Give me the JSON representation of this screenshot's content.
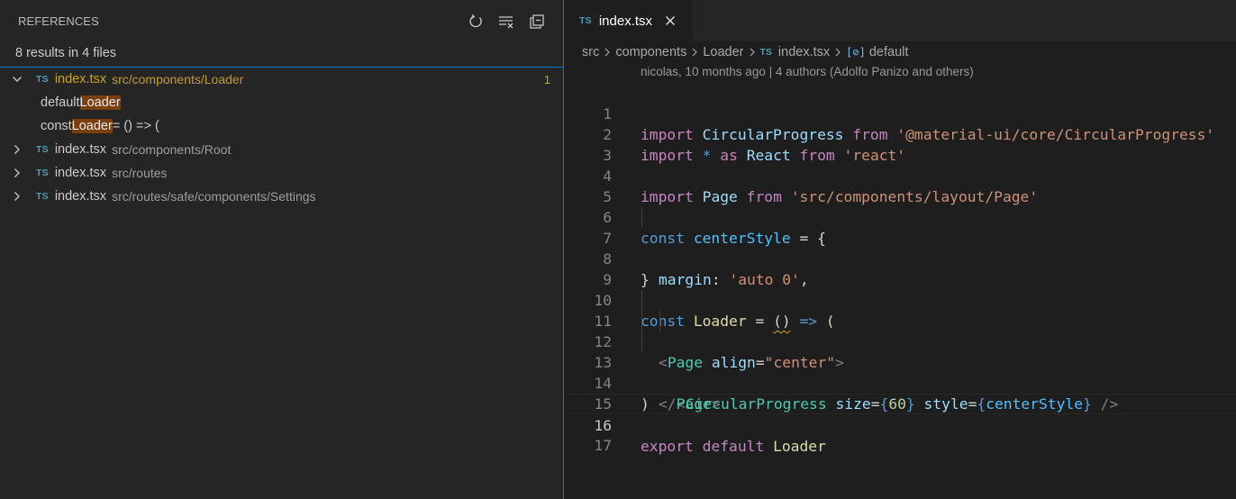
{
  "sidebar": {
    "title": "REFERENCES",
    "summary": "8 results in 4 files",
    "actions": [
      {
        "name": "refresh-icon"
      },
      {
        "name": "clear-all-icon"
      },
      {
        "name": "collapse-all-icon"
      }
    ],
    "files": [
      {
        "badge": "TS",
        "name": "index.tsx",
        "path": "src/components/Loader",
        "count": "1",
        "expanded": true
      },
      {
        "badge": "TS",
        "name": "index.tsx",
        "path": "src/components/Root",
        "expanded": false
      },
      {
        "badge": "TS",
        "name": "index.tsx",
        "path": "src/routes",
        "expanded": false
      },
      {
        "badge": "TS",
        "name": "index.tsx",
        "path": "src/routes/safe/components/Settings",
        "expanded": false
      }
    ],
    "matches": [
      {
        "before": "default ",
        "match": "Loader",
        "after": ""
      },
      {
        "before": "const ",
        "match": "Loader",
        "after": " = () => ("
      }
    ]
  },
  "editor": {
    "tab": {
      "badge": "TS",
      "label": "index.tsx"
    },
    "breadcrumb": {
      "parts": [
        "src",
        "components",
        "Loader"
      ],
      "file_badge": "TS",
      "file": "index.tsx",
      "symbol_icon": "[⊘]",
      "symbol": "default"
    },
    "blame": "nicolas, 10 months ago | 4 authors (Adolfo Panizo and others)",
    "line_numbers": [
      "1",
      "2",
      "3",
      "4",
      "5",
      "6",
      "7",
      "8",
      "9",
      "10",
      "11",
      "12",
      "13",
      "14",
      "15",
      "16",
      "17"
    ],
    "current_line": "16",
    "code": {
      "l1": [
        "import",
        " ",
        "CircularProgress",
        " ",
        "from",
        " ",
        "'@material-ui/core/CircularProgress'"
      ],
      "l2": [
        "import",
        " ",
        "*",
        " ",
        "as",
        " ",
        "React",
        " ",
        "from",
        " ",
        "'react'"
      ],
      "l4": [
        "import",
        " ",
        "Page",
        " ",
        "from",
        " ",
        "'src/components/layout/Page'"
      ],
      "l6": [
        "const",
        " ",
        "centerStyle",
        " ",
        "=",
        " ",
        "{"
      ],
      "l7": [
        "margin",
        ": ",
        "'auto 0'",
        ","
      ],
      "l8": [
        "}"
      ],
      "l10": [
        "const",
        " ",
        "Loader",
        " = ",
        "()",
        " ",
        "=>",
        " ",
        "("
      ],
      "l11": [
        "<",
        "Page",
        " ",
        "align",
        "=",
        "\"center\"",
        ">"
      ],
      "l12": [
        "<",
        "CircularProgress",
        " ",
        "size",
        "=",
        "{",
        "60",
        "}",
        " ",
        "style",
        "=",
        "{",
        "centerStyle",
        "}",
        " ",
        "/>"
      ],
      "l13": [
        "</",
        "Page",
        ">"
      ],
      "l14": [
        ")"
      ],
      "l16": [
        "export",
        " ",
        "default",
        " ",
        "Loader"
      ]
    }
  },
  "colors": {
    "accent": "#007acc",
    "match_highlight": "#7a3f0f",
    "active_file": "#cca700",
    "ts_badge": "#519aba"
  }
}
